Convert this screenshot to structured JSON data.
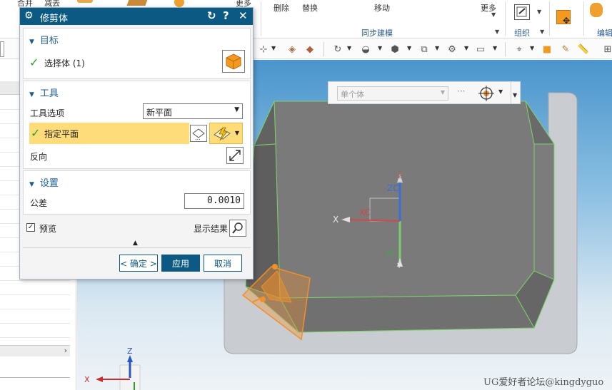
{
  "ribbon": {
    "top_left_labels": [
      "合并",
      "减去"
    ],
    "delete_label": "删除",
    "replace_label": "替换",
    "move_label": "移动",
    "more_label": "更多",
    "sync_group_label": "同步建模",
    "organize_group_label": "组织",
    "edit_group_label": "编辑"
  },
  "selection_bar": {
    "filter_value": "单个体",
    "dots": "···"
  },
  "dialog": {
    "title": "修剪体",
    "target": {
      "heading": "目标",
      "select_body_label": "选择体 (1)"
    },
    "tool": {
      "heading": "工具",
      "tool_option_label": "工具选项",
      "tool_option_value": "新平面",
      "specify_plane_label": "指定平面",
      "reverse_label": "反向"
    },
    "settings": {
      "heading": "设置",
      "tolerance_label": "公差",
      "tolerance_value": "0.0010"
    },
    "preview_label": "预览",
    "show_result_label": "显示结果",
    "ok_label": "< 确定 >",
    "apply_label": "应用",
    "cancel_label": "取消"
  },
  "viewport": {
    "axis_zc": "ZC",
    "axis_xc": "XC",
    "axis_yc": "YC",
    "axis_z_small": "Z",
    "axis_x_small": "X",
    "axis_y_small": "Y",
    "triad_z": "Z",
    "triad_x": "X"
  },
  "colors": {
    "title_bar": "#0c5a83",
    "highlight_row": "#fedc7a",
    "body_face": "#7a7a7a",
    "edge_green": "#7dd06a",
    "trim_plane_orange": "#f0902a"
  },
  "watermark": "UG爱好者论坛@kingdyguo"
}
